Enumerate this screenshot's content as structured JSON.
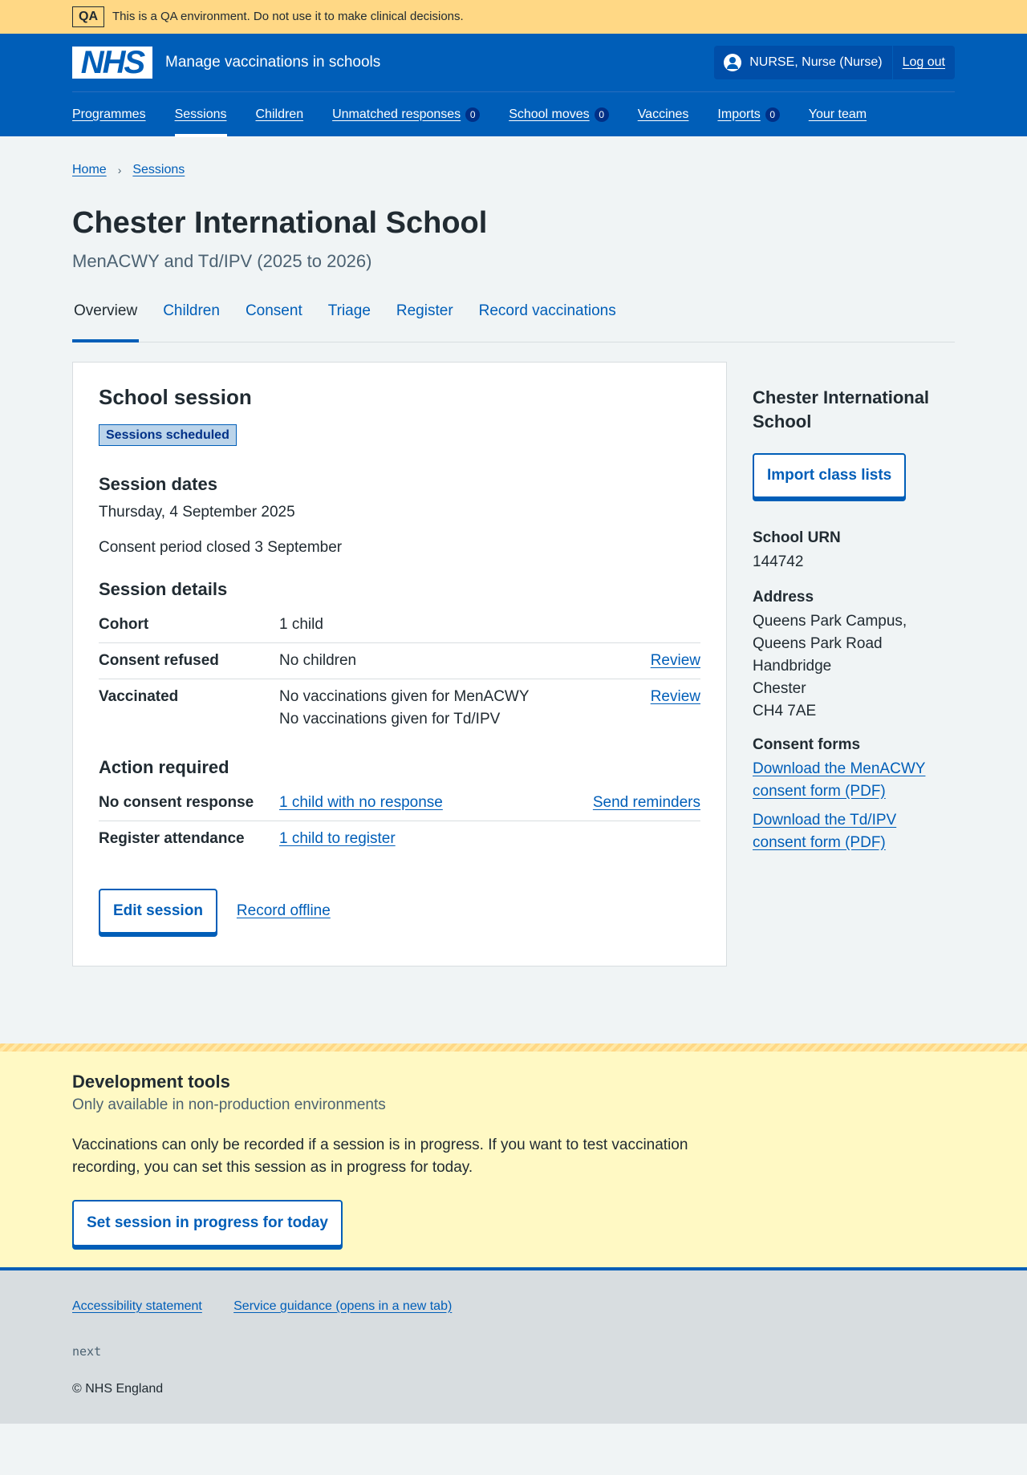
{
  "qa_banner": {
    "tag": "QA",
    "text": "This is a QA environment. Do not use it to make clinical decisions."
  },
  "header": {
    "logo_text": "NHS",
    "service_name": "Manage vaccinations in schools",
    "user": "NURSE, Nurse (Nurse)",
    "logout": "Log out",
    "nav": [
      {
        "label": "Programmes"
      },
      {
        "label": "Sessions",
        "active": true
      },
      {
        "label": "Children"
      },
      {
        "label": "Unmatched responses",
        "count": "0"
      },
      {
        "label": "School moves",
        "count": "0"
      },
      {
        "label": "Vaccines"
      },
      {
        "label": "Imports",
        "count": "0"
      },
      {
        "label": "Your team"
      }
    ]
  },
  "breadcrumb": {
    "home": "Home",
    "sep": "›",
    "sessions": "Sessions"
  },
  "page": {
    "title": "Chester International School",
    "caption": "MenACWY and Td/IPV (2025 to 2026)"
  },
  "tabs": [
    "Overview",
    "Children",
    "Consent",
    "Triage",
    "Register",
    "Record vaccinations"
  ],
  "card": {
    "heading": "School session",
    "status": "Sessions scheduled",
    "dates_heading": "Session dates",
    "date": "Thursday, 4 September 2025",
    "consent_period": "Consent period closed 3 September",
    "details_heading": "Session details",
    "details": {
      "cohort_key": "Cohort",
      "cohort_val": "1 child",
      "refused_key": "Consent refused",
      "refused_val": "No children",
      "refused_action": "Review",
      "vaccinated_key": "Vaccinated",
      "vaccinated_val_1": "No vaccinations given for MenACWY",
      "vaccinated_val_2": "No vaccinations given for Td/IPV",
      "vaccinated_action": "Review"
    },
    "action_heading": "Action required",
    "actions": {
      "no_consent_key": "No consent response",
      "no_consent_link": "1 child with no response",
      "no_consent_action": "Send reminders",
      "register_key": "Register attendance",
      "register_link": "1 child to register"
    },
    "edit_button": "Edit session",
    "offline_link": "Record offline"
  },
  "side": {
    "heading": "Chester International School",
    "import_button": "Import class lists",
    "urn_label": "School URN",
    "urn": "144742",
    "address_label": "Address",
    "address": [
      "Queens Park Campus,",
      "Queens Park Road",
      "Handbridge",
      "Chester",
      "CH4 7AE"
    ],
    "consent_forms_label": "Consent forms",
    "form_1": "Download the MenACWY consent form (PDF)",
    "form_2": "Download the Td/IPV consent form (PDF)"
  },
  "dev_tools": {
    "heading": "Development tools",
    "sub": "Only available in non-production environments",
    "text": "Vaccinations can only be recorded if a session is in progress. If you want to test vaccination recording, you can set this session as in progress for today.",
    "button": "Set session in progress for today"
  },
  "footer": {
    "accessibility": "Accessibility statement",
    "guidance": "Service guidance (opens in a new tab)",
    "version": "next",
    "copyright": "© NHS England"
  }
}
